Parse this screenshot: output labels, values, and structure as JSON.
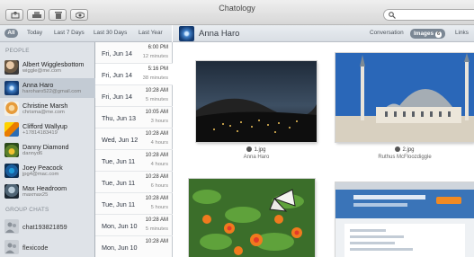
{
  "window": {
    "title": "Chatology"
  },
  "toolbar": {
    "search_placeholder": ""
  },
  "filters": [
    "All",
    "Today",
    "Last 7 Days",
    "Last 30 Days",
    "Last Year"
  ],
  "sidebar": {
    "people_header": "PEOPLE",
    "people": [
      {
        "name": "Albert Wigglesbottom",
        "handle": "wiggle@me.com"
      },
      {
        "name": "Anna Haro",
        "handle": "haroharo522@gmail.com"
      },
      {
        "name": "Christine Marsh",
        "handle": "chrisma@me.com"
      },
      {
        "name": "Clifford Wallyup",
        "handle": "+17814183419"
      },
      {
        "name": "Danny Diamond",
        "handle": "dannyd6"
      },
      {
        "name": "Joey Peacock",
        "handle": "jpg4@mac.com"
      },
      {
        "name": "Max Headroom",
        "handle": "maxmax25"
      }
    ],
    "group_header": "GROUP CHATS",
    "groups": [
      {
        "name": "chat193821859"
      },
      {
        "name": "flexicode"
      }
    ]
  },
  "conversations": [
    {
      "date": "Fri, Jun 14",
      "time": "6:00 PM",
      "duration": "12 minutes"
    },
    {
      "date": "Fri, Jun 14",
      "time": "5:16 PM",
      "duration": "38 minutes"
    },
    {
      "date": "Fri, Jun 14",
      "time": "10:28 AM",
      "duration": "5 minutes"
    },
    {
      "date": "Thu, Jun 13",
      "time": "10:05 AM",
      "duration": "3 hours"
    },
    {
      "date": "Wed, Jun 12",
      "time": "10:28 AM",
      "duration": "4 hours"
    },
    {
      "date": "Tue, Jun 11",
      "time": "10:28 AM",
      "duration": "4 hours"
    },
    {
      "date": "Tue, Jun 11",
      "time": "10:28 AM",
      "duration": "6 hours"
    },
    {
      "date": "Tue, Jun 11",
      "time": "10:28 AM",
      "duration": "5 hours"
    },
    {
      "date": "Mon, Jun 10",
      "time": "10:28 AM",
      "duration": "5 minutes"
    },
    {
      "date": "Mon, Jun 10",
      "time": "10:28 AM",
      "duration": ""
    }
  ],
  "detail": {
    "contact_name": "Anna Haro",
    "tabs": {
      "conversation": "Conversation",
      "images": "Images",
      "images_count": "6",
      "links": "Links"
    },
    "images": [
      {
        "filename": "1.jpg",
        "sender": "Anna Haro"
      },
      {
        "filename": "2.jpg",
        "sender": "Ruthus McFloozdiggle"
      },
      {
        "filename": "",
        "sender": ""
      },
      {
        "filename": "",
        "sender": ""
      }
    ]
  },
  "colors": {
    "sidebar_bg": "#dfe3e8",
    "selected_row": "#c3cbd4",
    "active_pill": "#7b8794"
  }
}
